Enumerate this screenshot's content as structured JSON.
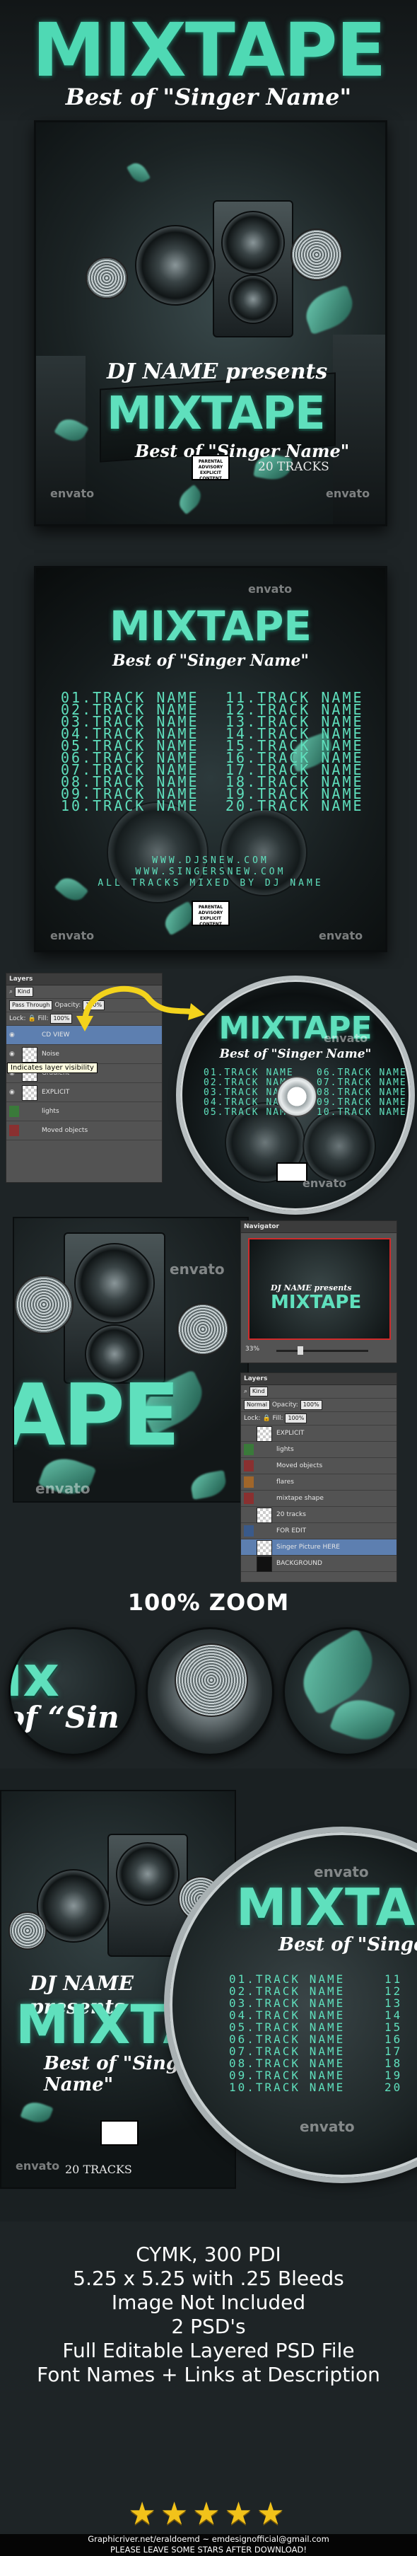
{
  "header": {
    "title": "MIXTAPE",
    "subtitle": "Best of \"Singer Name\""
  },
  "cover_front": {
    "dj_line": "DJ NAME presents",
    "title": "MIXTAPE",
    "subtitle": "Best of \"Singer Name\"",
    "tracks": "20 TRACKS",
    "parental_advisory": "PARENTAL ADVISORY EXPLICIT CONTENT",
    "watermark": "envato"
  },
  "cover_back": {
    "title": "MIXTAPE",
    "subtitle": "Best of \"Singer Name\"",
    "tracks_left": [
      "01.TRACK NAME",
      "02.TRACK NAME",
      "03.TRACK NAME",
      "04.TRACK NAME",
      "05.TRACK NAME",
      "06.TRACK NAME",
      "07.TRACK NAME",
      "08.TRACK NAME",
      "09.TRACK NAME",
      "10.TRACK NAME"
    ],
    "tracks_right": [
      "11.TRACK NAME",
      "12.TRACK NAME",
      "13.TRACK NAME",
      "14.TRACK NAME",
      "15.TRACK NAME",
      "16.TRACK NAME",
      "17.TRACK NAME",
      "18.TRACK NAME",
      "19.TRACK NAME",
      "20.TRACK NAME"
    ],
    "web_lines": [
      "WWW.DJSNEW.COM",
      "WWW.SINGERSNEW.COM",
      "ALL TRACKS MIXED BY DJ NAME"
    ],
    "parental_advisory": "PARENTAL ADVISORY EXPLICIT CONTENT",
    "watermark": "envato"
  },
  "layers_panel": {
    "title": "Layers",
    "kind": "Kind",
    "blend": "Pass Through",
    "opacity_label": "Opacity:",
    "opacity": "100%",
    "lock_label": "Lock:",
    "fill_label": "Fill:",
    "fill": "100%",
    "tooltip": "Indicates layer visibility",
    "rows": [
      "CD VIEW",
      "Noise",
      "Gradient",
      "EXPLICIT",
      "lights",
      "Moved objects"
    ]
  },
  "cd_label": {
    "title": "MIXTAPE",
    "subtitle": "Best of \"Singer Name\"",
    "tracks": [
      "01.TRACK NAME",
      "02.TRACK NAME",
      "03.TRACK NAME",
      "04.TRACK NAME",
      "05.TRACK NAME"
    ],
    "tracks_right": [
      "06.TRACK NAME",
      "07.TRACK NAME",
      "08.TRACK NAME",
      "09.TRACK NAME",
      "10.TRACK NAME"
    ],
    "watermark": "envato"
  },
  "navigator": {
    "title": "Navigator",
    "zoom": "33%",
    "dj_line": "DJ NAME presents",
    "title_text": "MIXTAPE"
  },
  "layers_panel_2": {
    "title": "Layers",
    "kind": "Kind",
    "blend": "Normal",
    "opacity_label": "Opacity:",
    "opacity": "100%",
    "lock_label": "Lock:",
    "fill_label": "Fill:",
    "fill": "100%",
    "rows": [
      "EXPLICIT",
      "lights",
      "Moved objects",
      "flares",
      "mixtape shape",
      "20 tracks",
      "FOR EDIT",
      "Singer Picture HERE",
      "BACKGROUND"
    ]
  },
  "closeup": {
    "text": "APE",
    "watermark": "envato"
  },
  "zoom": {
    "label": "100% ZOOM",
    "z1_text": "ix",
    "z1_text2": "of “Sin"
  },
  "composite": {
    "dj_line": "DJ NAME presents",
    "title": "MIXTAPE",
    "subtitle": "Best of \"Singer Name\"",
    "tracks": "20 TRACKS",
    "cd_title": "MIXTAPE",
    "cd_subtitle": "Best of \"Singer Name\"",
    "cd_tracks": [
      "01.TRACK NAME",
      "02.TRACK NAME",
      "03.TRACK NAME",
      "04.TRACK NAME",
      "05.TRACK NAME",
      "06.TRACK NAME",
      "07.TRACK NAME",
      "08.TRACK NAME",
      "09.TRACK NAME",
      "10.TRACK NAME"
    ],
    "cd_numbers": [
      "11",
      "12",
      "13",
      "14",
      "15",
      "16",
      "17",
      "18",
      "19",
      "20"
    ],
    "watermark": "envato"
  },
  "info": {
    "lines": [
      "CYMK, 300 PDI",
      "5.25 x 5.25 with .25 Bleeds",
      "Image Not Included",
      "2 PSD's",
      "Full Editable Layered PSD File",
      "Font Names + Links at Description"
    ]
  },
  "rating": {
    "stars": "★★★★★"
  },
  "footer": {
    "line1": "Graphicriver.net/eraldoemd ~ emdesignofficial@gmail.com",
    "line2": "PLEASE LEAVE SOME STARS AFTER DOWNLOAD!"
  },
  "colors": {
    "accent": "#5fe0bd",
    "background": "#1e2426",
    "star": "#f2c21a"
  }
}
